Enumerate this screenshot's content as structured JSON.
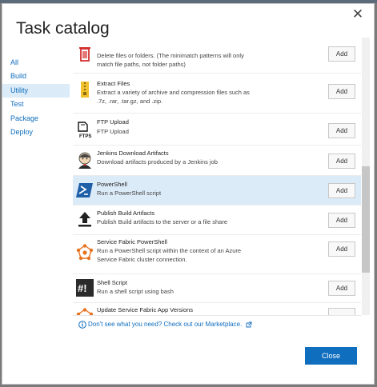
{
  "dialog": {
    "title": "Task catalog",
    "close_glyph": "✕"
  },
  "nav": [
    {
      "label": "All",
      "selected": false
    },
    {
      "label": "Build",
      "selected": false
    },
    {
      "label": "Utility",
      "selected": true
    },
    {
      "label": "Test",
      "selected": false
    },
    {
      "label": "Package",
      "selected": false
    },
    {
      "label": "Deploy",
      "selected": false
    }
  ],
  "tasks": [
    {
      "name": "",
      "description": "Delete files or folders. (The minimatch patterns will only match file paths, not folder paths)",
      "add_label": "Add",
      "icon": "trash-icon"
    },
    {
      "name": "Extract Files",
      "description": "Extract a variety of archive and compression files such as .7z, .rar, .tar.gz, and .zip.",
      "add_label": "Add",
      "icon": "zip-archive-icon"
    },
    {
      "name": "FTP Upload",
      "description": "FTP Upload",
      "add_label": "Add",
      "icon": "ftps-icon",
      "icon_text": "FTPS"
    },
    {
      "name": "Jenkins Download Artifacts",
      "description": "Download artifacts produced by a Jenkins job",
      "add_label": "Add",
      "icon": "jenkins-icon"
    },
    {
      "name": "PowerShell",
      "description": "Run a PowerShell script",
      "add_label": "Add",
      "icon": "powershell-icon",
      "selected": true
    },
    {
      "name": "Publish Build Artifacts",
      "description": "Publish Build artifacts to the server or a file share",
      "add_label": "Add",
      "icon": "upload-arrow-icon"
    },
    {
      "name": "Service Fabric PowerShell",
      "description": "Run a PowerShell script within the context of an Azure Service Fabric cluster connection.",
      "add_label": "Add",
      "icon": "service-fabric-icon"
    },
    {
      "name": "Shell Script",
      "description": "Run a shell script using bash",
      "add_label": "Add",
      "icon": "shell-script-icon",
      "icon_text": "#!"
    },
    {
      "name": "Update Service Fabric App Versions",
      "description": "",
      "add_label": "",
      "icon": "service-fabric-icon"
    }
  ],
  "marketplace_link": "Don't see what you need? Check out our Marketplace.",
  "close_button": "Close",
  "colors": {
    "accent": "#106ebe",
    "selected_bg": "#dcebf8",
    "fabric_orange": "#e8731f",
    "powershell_blue": "#1f5fa8"
  }
}
